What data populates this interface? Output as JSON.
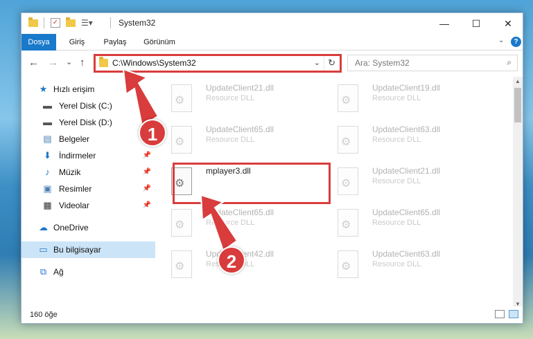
{
  "window": {
    "title": "System32",
    "controls": {
      "minimize": "—",
      "maximize": "☐",
      "close": "✕"
    }
  },
  "ribbon": {
    "tabs": [
      {
        "label": "Dosya"
      },
      {
        "label": "Giriş"
      },
      {
        "label": "Paylaş"
      },
      {
        "label": "Görünüm"
      }
    ],
    "help": "?"
  },
  "navigation": {
    "back": "←",
    "forward": "→",
    "recent": "⌄",
    "up": "↑",
    "address": "C:\\Windows\\System32",
    "search_placeholder": "Ara: System32"
  },
  "sidebar": {
    "items": [
      {
        "label": "Hızlı erişim",
        "icon": "star-icon",
        "glyph": "★",
        "color": "#1e78c8"
      },
      {
        "label": "Yerel Disk (C:)",
        "icon": "drive-icon",
        "glyph": "▬",
        "color": "#555555"
      },
      {
        "label": "Yerel Disk (D:)",
        "icon": "drive-icon",
        "glyph": "▬",
        "color": "#555555"
      },
      {
        "label": "Belgeler",
        "icon": "documents-icon",
        "glyph": "▤",
        "color": "#4a7fb5"
      },
      {
        "label": "İndirmeler",
        "icon": "download-icon",
        "glyph": "⬇",
        "color": "#1e78c8"
      },
      {
        "label": "Müzik",
        "icon": "music-icon",
        "glyph": "♪",
        "color": "#1e78c8"
      },
      {
        "label": "Resimler",
        "icon": "pictures-icon",
        "glyph": "▣",
        "color": "#4a7fb5"
      },
      {
        "label": "Videolar",
        "icon": "video-icon",
        "glyph": "▦",
        "color": "#333333"
      },
      {
        "label": "OneDrive",
        "icon": "cloud-icon",
        "glyph": "☁",
        "color": "#1e78c8"
      },
      {
        "label": "Bu bilgisayar",
        "icon": "computer-icon",
        "glyph": "▭",
        "color": "#1e78c8"
      },
      {
        "label": "Ağ",
        "icon": "network-icon",
        "glyph": "⧉",
        "color": "#1e78c8"
      }
    ]
  },
  "files": [
    {
      "name": "UpdateClient21.dll",
      "type": "Resource DLL"
    },
    {
      "name": "UpdateClient19.dll",
      "type": "Resource DLL"
    },
    {
      "name": "UpdateClient65.dll",
      "type": "Resource DLL"
    },
    {
      "name": "UpdateClient63.dll",
      "type": "Resource DLL"
    },
    {
      "name": "mplayer3.dll",
      "type": ""
    },
    {
      "name": "UpdateClient21.dll",
      "type": "Resource DLL"
    },
    {
      "name": "UpdateClient65.dll",
      "type": "Resource DLL"
    },
    {
      "name": "UpdateClient65.dll",
      "type": "Resource DLL"
    },
    {
      "name": "UpdateClient42.dll",
      "type": "Resource DLL"
    },
    {
      "name": "UpdateClient63.dll",
      "type": "Resource DLL"
    }
  ],
  "status": {
    "count": "160 öğe"
  },
  "callouts": {
    "one": "1",
    "two": "2"
  },
  "colors": {
    "accent": "#1979ca",
    "highlight": "#d93c3c"
  }
}
